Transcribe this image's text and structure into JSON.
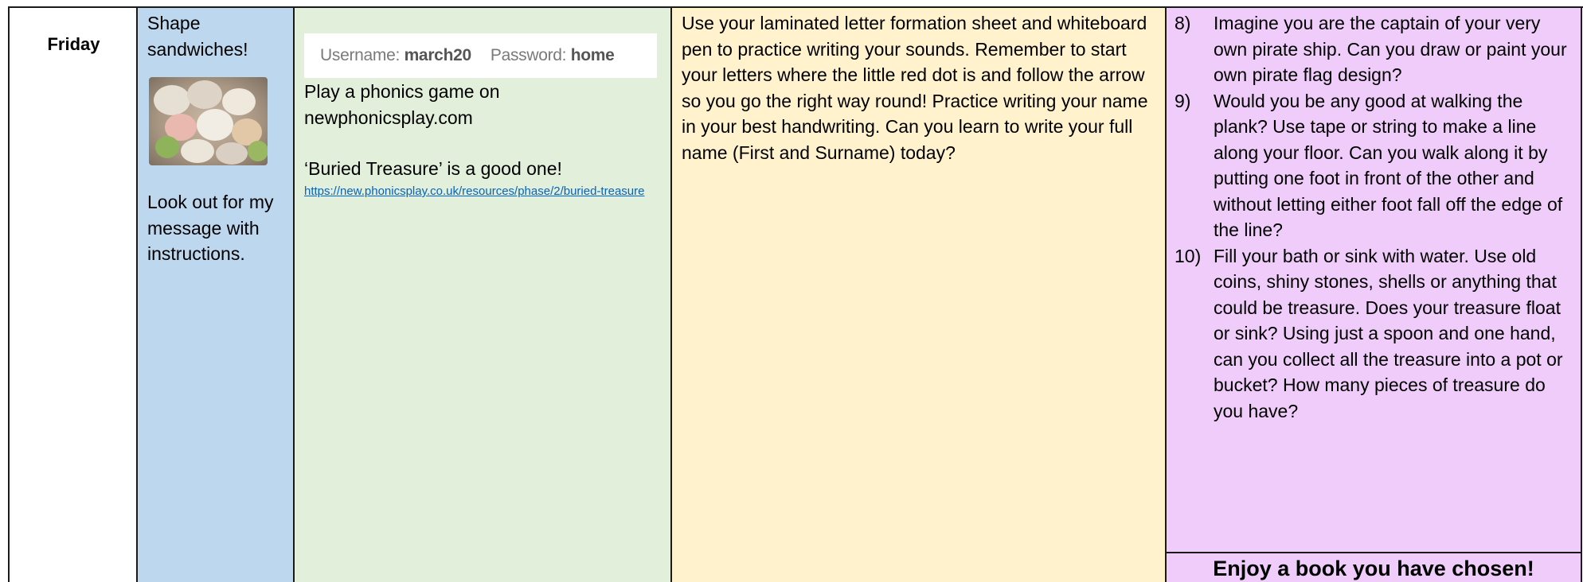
{
  "day": "Friday",
  "activity_1": {
    "title": "Shape sandwiches!",
    "image_alt": "plate of shape sandwiches",
    "message": "Look out for my message with instructions."
  },
  "phonics": {
    "username_label": "Username:",
    "username_value": "march20",
    "password_label": "Password:",
    "password_value": "home",
    "play_text": "Play a phonics game on newphonicsplay.com",
    "buried_text": "‘Buried Treasure’ is a good one!",
    "link": "https://new.phonicsplay.co.uk/resources/phase/2/buried-treasure"
  },
  "writing": {
    "text": "Use your laminated letter formation sheet and whiteboard pen to practice writing your sounds. Remember to start your letters where the little red dot is and follow the arrow so you go the right way round! Practice writing your name in your best handwriting. Can you learn to write your full name (First and Surname) today?"
  },
  "pirate": {
    "items": [
      {
        "num": "8)",
        "text": "Imagine you are the captain of your very own pirate ship. Can you draw or paint your own pirate flag design?"
      },
      {
        "num": "9)",
        "text": "Would you be any good at walking the plank? Use tape or string to make a line along your floor. Can you walk along it by putting one foot in front of the other and without letting either foot fall off the edge of the line?"
      },
      {
        "num": "10)",
        "text": "Fill your bath or sink with water. Use old coins, shiny stones, shells or anything that could be treasure. Does your treasure float or sink? Using just a spoon and one hand, can you collect all the treasure into a pot or bucket? How many pieces of treasure do you have?"
      }
    ],
    "footer": "Enjoy a book you have chosen!"
  },
  "colors": {
    "blue": "#bdd7ee",
    "green": "#e2efda",
    "yellow": "#fff2cc",
    "pink": "#f0ccfa",
    "link": "#0563c1"
  }
}
